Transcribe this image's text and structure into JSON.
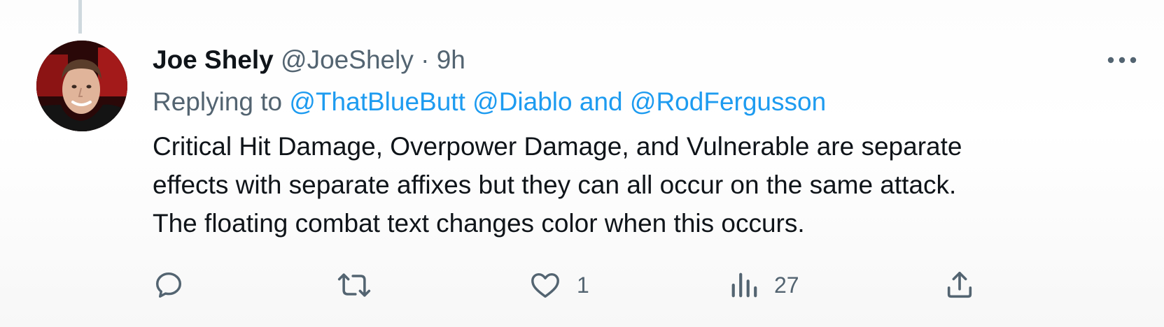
{
  "tweet": {
    "author_name": "Joe Shely",
    "author_handle": "@JoeShely",
    "separator": "·",
    "time": "9h",
    "replying_to_label": "Replying to",
    "mentions": [
      "@ThatBlueButt",
      "@Diablo",
      "@RodFergusson"
    ],
    "mention_joiner": "and",
    "body_lines": [
      "Critical Hit Damage, Overpower Damage, and Vulnerable are separate",
      "effects with separate affixes but they can all occur on the same attack.",
      "The floating combat text changes color when this occurs."
    ]
  },
  "actions": {
    "reply_icon": "reply-icon",
    "retweet_icon": "retweet-icon",
    "like_icon": "heart-icon",
    "like_count": "1",
    "views_icon": "views-icon",
    "views_count": "27",
    "share_icon": "share-icon"
  },
  "colors": {
    "mention": "#1d9bf0",
    "secondary_text": "#536471",
    "primary_text": "#0f1419"
  }
}
